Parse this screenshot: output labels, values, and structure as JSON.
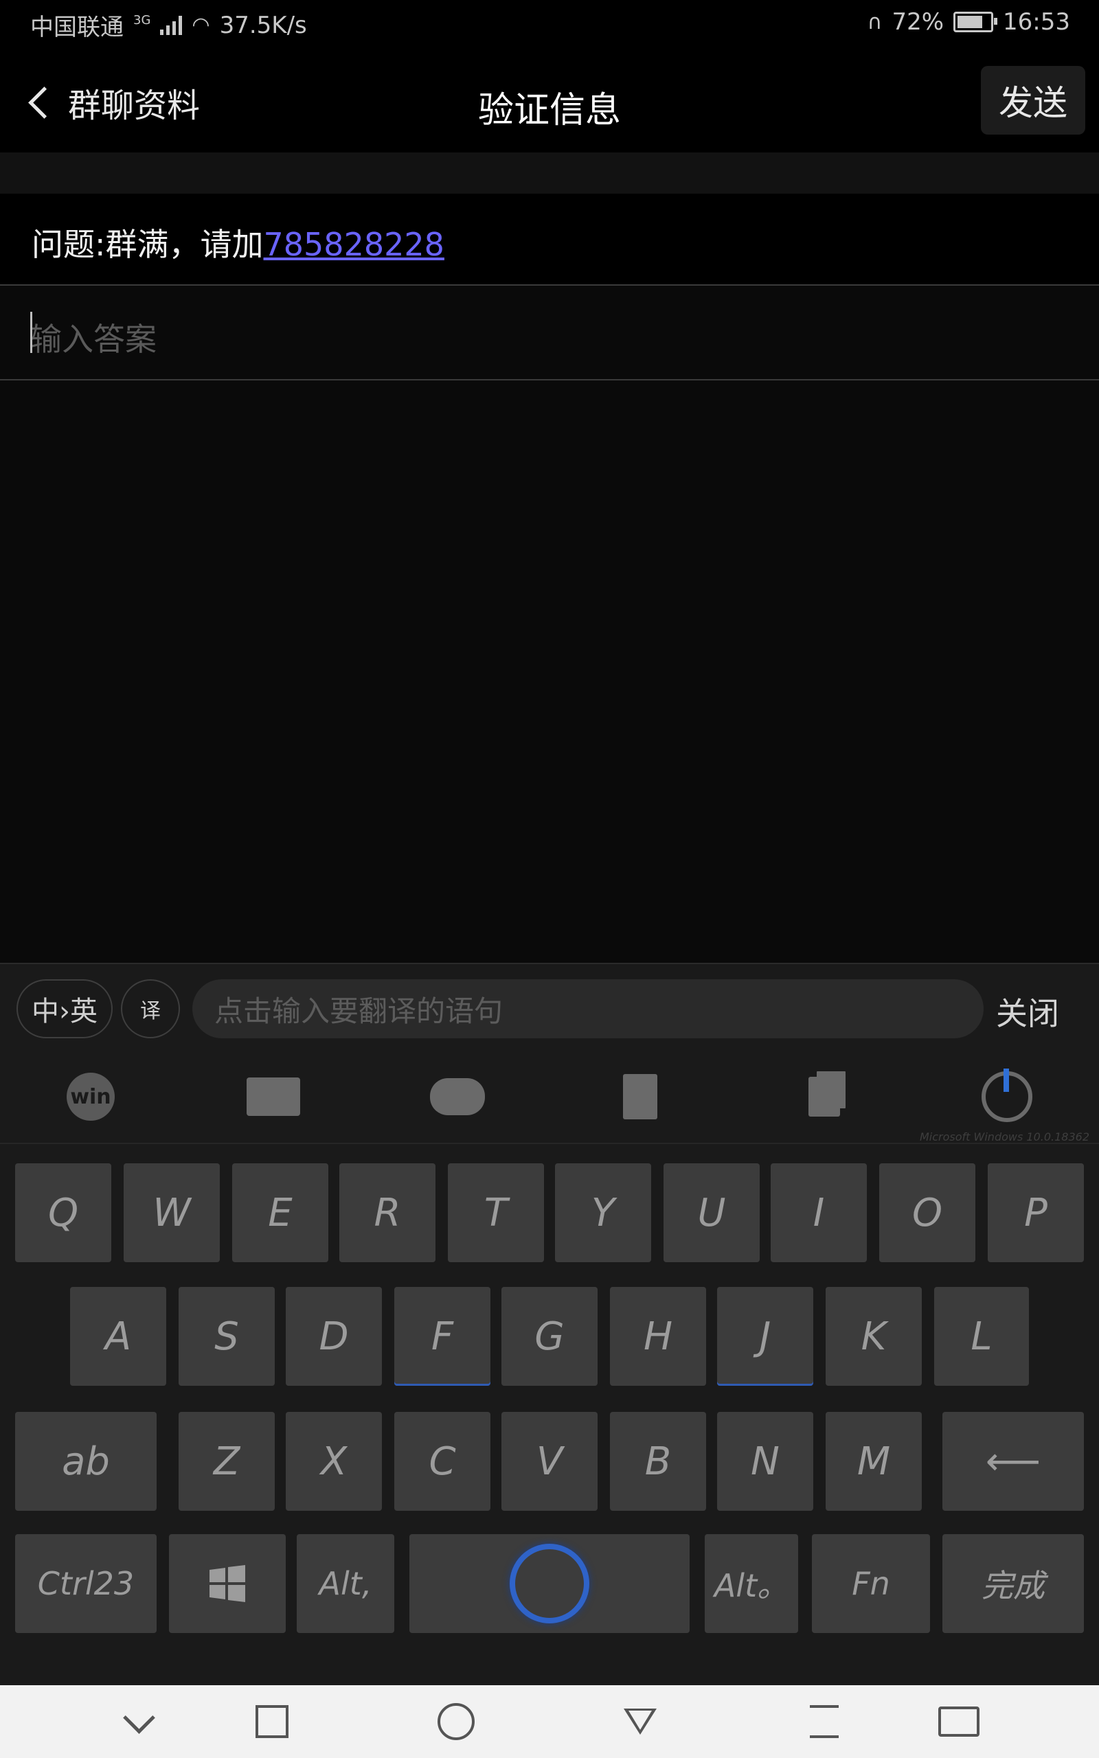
{
  "status_bar": {
    "carrier": "中国联通",
    "network": "3G",
    "speed": "37.5K/s",
    "battery": "72%",
    "time": "16:53"
  },
  "header": {
    "back_label": "群聊资料",
    "title": "验证信息",
    "send_label": "发送"
  },
  "question": {
    "prefix": "问题:群满，请加",
    "link": "785828228"
  },
  "answer": {
    "placeholder": "输入答案"
  },
  "keyboard": {
    "lang_toggle": "中›英",
    "translate_icon": "译",
    "translate_placeholder": "点击输入要翻译的语句",
    "close_label": "关闭",
    "win_icon_text": "win",
    "windows_info": "Microsoft Windows 10.0.18362",
    "row1": [
      "Q",
      "W",
      "E",
      "R",
      "T",
      "Y",
      "U",
      "I",
      "O",
      "P"
    ],
    "row2": [
      "A",
      "S",
      "D",
      "F",
      "G",
      "H",
      "J",
      "K",
      "L"
    ],
    "row3": [
      "ab",
      "Z",
      "X",
      "C",
      "V",
      "B",
      "N",
      "M",
      "⟵"
    ],
    "row4": {
      "ctrl": "Ctrl23",
      "alt_left": "Alt,",
      "alt_right": "Alt。",
      "fn": "Fn",
      "done": "完成"
    }
  }
}
